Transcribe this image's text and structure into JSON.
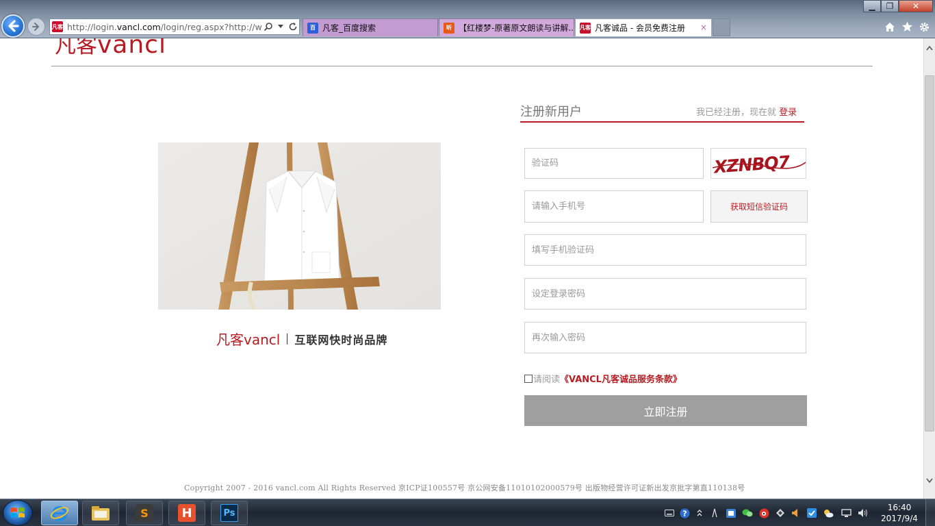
{
  "browser": {
    "address": {
      "url_prefix": "http://login.",
      "url_domain": "vancl.com",
      "url_suffix": "/login/reg.aspx?http://www.",
      "search_icon": "search-icon",
      "refresh_icon": "refresh-icon"
    },
    "tabs": [
      {
        "label": "凡客_百度搜索",
        "icon": "baidu-favicon"
      },
      {
        "label": "【红楼梦-原著原文朗读与讲解...",
        "icon": "ting-favicon"
      },
      {
        "label": "凡客诚品 - 会员免费注册",
        "icon": "vancl-favicon",
        "close": "×"
      }
    ],
    "favicon_text": {
      "vancl": "凡客",
      "baidu": "百",
      "ting": "听"
    },
    "window_buttons": {
      "minimize": "▁",
      "maximize": "❐",
      "close": "✕"
    },
    "colors": {
      "vancl_red": "#b81c22"
    }
  },
  "page": {
    "logo": {
      "cn": "凡客",
      "en": "vancl"
    },
    "form": {
      "title": "注册新用户",
      "login_prompt": "我已经注册，现在就",
      "login_link": "登录",
      "captcha_placeholder": "验证码",
      "captcha_text": "XZNBQ7",
      "phone_placeholder": "请输入手机号",
      "sms_button": "获取短信验证码",
      "sms_code_placeholder": "填写手机验证码",
      "password_placeholder": "设定登录密码",
      "confirm_placeholder": "再次输入密码",
      "agree_text": "请阅读",
      "terms_link": "《VANCL凡客诚品服务条款》",
      "agree_checked": false,
      "submit": "立即注册"
    },
    "brand": {
      "logo": "凡客vancl",
      "slogan": "互联网快时尚品牌"
    },
    "copyright": "Copyright 2007 - 2016 vancl.com All Rights Reserved 京ICP证100557号 京公网安备11010102000579号 出版物经营许可证新出发京批字第直110138号"
  },
  "taskbar": {
    "apps": [
      "Internet Explorer",
      "Windows Explorer",
      "Sublime Text",
      "HBuilder",
      "Photoshop"
    ],
    "app_glyphs": {
      "sublime": "S",
      "hbuilder": "H",
      "ps": "Ps"
    },
    "clock": {
      "time": "16:40",
      "date": "2017/9/4"
    }
  }
}
